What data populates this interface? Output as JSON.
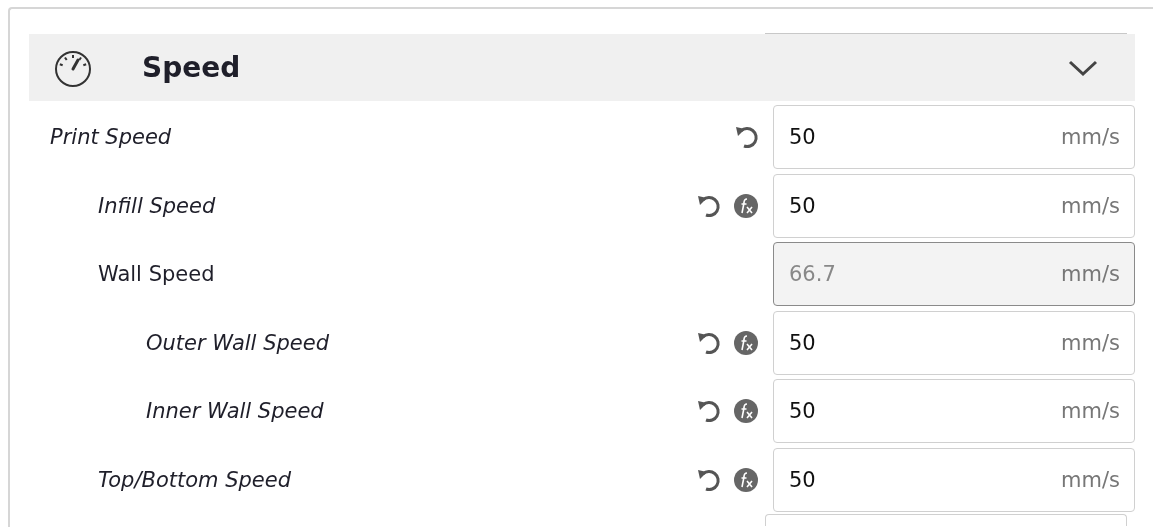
{
  "section": {
    "title": "Speed",
    "expanded": true
  },
  "settings": [
    {
      "label": "Print Speed",
      "value": "50",
      "unit": "mm/s",
      "modified": true,
      "formula": false,
      "disabled": false,
      "children": [
        {
          "label": "Infill Speed",
          "value": "50",
          "unit": "mm/s",
          "modified": true,
          "formula": true,
          "disabled": false
        },
        {
          "label": "Wall Speed",
          "value": "66.7",
          "unit": "mm/s",
          "modified": false,
          "formula": false,
          "disabled": true,
          "children": [
            {
              "label": "Outer Wall Speed",
              "value": "50",
              "unit": "mm/s",
              "modified": true,
              "formula": true,
              "disabled": false
            },
            {
              "label": "Inner Wall Speed",
              "value": "50",
              "unit": "mm/s",
              "modified": true,
              "formula": true,
              "disabled": false
            }
          ]
        },
        {
          "label": "Top/Bottom Speed",
          "value": "50",
          "unit": "mm/s",
          "modified": true,
          "formula": true,
          "disabled": false
        }
      ]
    }
  ]
}
